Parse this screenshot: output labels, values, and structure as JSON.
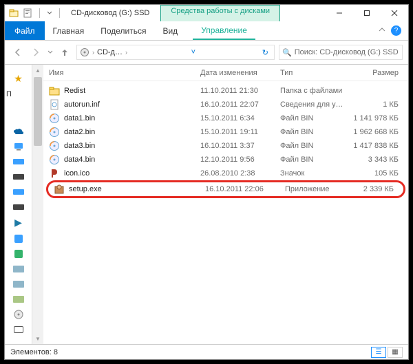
{
  "window": {
    "title": "CD-дисковод (G:) SSD",
    "context_tab_group_label": "Средства работы с дисками",
    "context_tab_label": "Управление"
  },
  "ribbon": {
    "file": "Файл",
    "home": "Главная",
    "share": "Поделиться",
    "view": "Вид"
  },
  "address": {
    "crumb": "CD-д…",
    "search_placeholder": "Поиск: CD-дисковод (G:) SSD"
  },
  "nav_pane": {
    "favorites_label_truncated": "П"
  },
  "columns": {
    "name": "Имя",
    "date": "Дата изменения",
    "type": "Тип",
    "size": "Размер"
  },
  "files": [
    {
      "icon": "folder",
      "name": "Redist",
      "date": "11.10.2011 21:30",
      "type": "Папка с файлами",
      "size": ""
    },
    {
      "icon": "inf",
      "name": "autorun.inf",
      "date": "16.10.2011 22:07",
      "type": "Сведения для уст…",
      "size": "1 КБ"
    },
    {
      "icon": "bin",
      "name": "data1.bin",
      "date": "15.10.2011 6:34",
      "type": "Файл BIN",
      "size": "1 141 978 КБ"
    },
    {
      "icon": "bin",
      "name": "data2.bin",
      "date": "15.10.2011 19:11",
      "type": "Файл BIN",
      "size": "1 962 668 КБ"
    },
    {
      "icon": "bin",
      "name": "data3.bin",
      "date": "16.10.2011 3:37",
      "type": "Файл BIN",
      "size": "1 417 838 КБ"
    },
    {
      "icon": "bin",
      "name": "data4.bin",
      "date": "12.10.2011 9:56",
      "type": "Файл BIN",
      "size": "3 343 КБ"
    },
    {
      "icon": "ico",
      "name": "icon.ico",
      "date": "26.08.2010 2:38",
      "type": "Значок",
      "size": "105 КБ"
    },
    {
      "icon": "exe",
      "name": "setup.exe",
      "date": "16.10.2011 22:06",
      "type": "Приложение",
      "size": "2 339 КБ",
      "highlighted": true
    }
  ],
  "status": {
    "item_count_label": "Элементов: 8"
  }
}
